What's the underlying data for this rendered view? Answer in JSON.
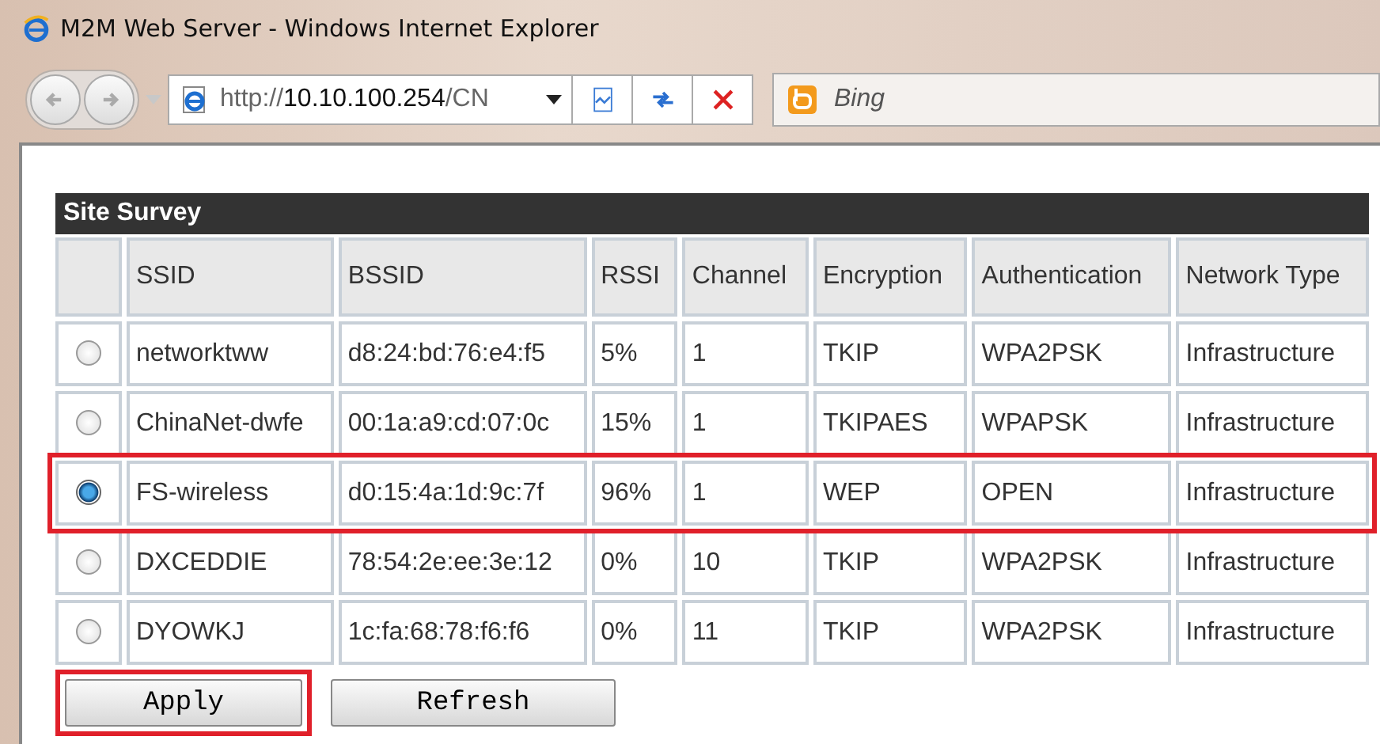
{
  "window": {
    "title": "M2M Web Server - Windows Internet Explorer"
  },
  "address_bar": {
    "url_parts": [
      "http://",
      "10.10.100.254",
      "/CN"
    ]
  },
  "search": {
    "placeholder": "Bing"
  },
  "survey": {
    "title": "Site Survey",
    "columns": [
      "",
      "SSID",
      "BSSID",
      "RSSI",
      "Channel",
      "Encryption",
      "Authentication",
      "Network Type"
    ],
    "rows": [
      {
        "selected": false,
        "highlighted": false,
        "cells": [
          "",
          "networktww",
          "d8:24:bd:76:e4:f5",
          "5%",
          "1",
          "TKIP",
          "WPA2PSK",
          "Infrastructure"
        ]
      },
      {
        "selected": false,
        "highlighted": false,
        "cells": [
          "",
          "ChinaNet-dwfe",
          "00:1a:a9:cd:07:0c",
          "15%",
          "1",
          "TKIPAES",
          "WPAPSK",
          "Infrastructure"
        ]
      },
      {
        "selected": true,
        "highlighted": true,
        "cells": [
          "",
          "FS-wireless",
          "d0:15:4a:1d:9c:7f",
          "96%",
          "1",
          "WEP",
          "OPEN",
          "Infrastructure"
        ]
      },
      {
        "selected": false,
        "highlighted": false,
        "cells": [
          "",
          "DXCEDDIE",
          "78:54:2e:ee:3e:12",
          "0%",
          "10",
          "TKIP",
          "WPA2PSK",
          "Infrastructure"
        ]
      },
      {
        "selected": false,
        "highlighted": false,
        "cells": [
          "",
          "DYOWKJ",
          "1c:fa:68:78:f6:f6",
          "0%",
          "11",
          "TKIP",
          "WPA2PSK",
          "Infrastructure"
        ]
      }
    ]
  },
  "buttons": [
    {
      "label": "Apply",
      "highlighted": true
    },
    {
      "label": "Refresh",
      "highlighted": false
    }
  ]
}
